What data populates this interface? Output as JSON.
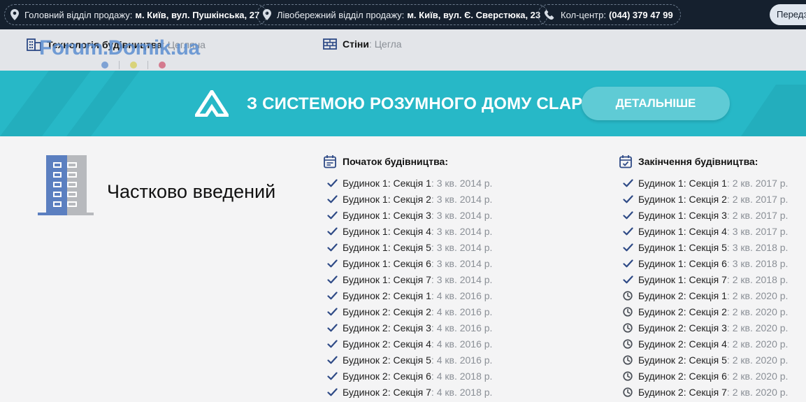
{
  "topbar": {
    "offices": [
      {
        "label": "Головний відділ продажу:",
        "value": "м. Київ, вул. Пушкінська, 27"
      },
      {
        "label": "Лівобережний відділ продажу:",
        "value": "м. Київ, вул. Є. Сверстюка, 23"
      }
    ],
    "callcenter": {
      "label": "Кол-центр:",
      "value": "(044) 379 47 99"
    },
    "callback_label": "Передз"
  },
  "specs": {
    "technology": {
      "label": "Технологія будівництва",
      "value": ": Цегляна"
    },
    "walls": {
      "label": "Стіни",
      "value": ": Цегла"
    },
    "watermark": "Forum.Domik.ua"
  },
  "banner": {
    "title": "З СИСТЕМОЮ РОЗУМНОГО ДОМУ CLAP",
    "button": "ДЕТАЛЬНІШЕ"
  },
  "status": {
    "text": "Частково введений"
  },
  "start": {
    "title": "Початок будівництва:",
    "items": [
      {
        "name": "Будинок 1: Секція 1",
        "date": ": 3 кв. 2014 р.",
        "icon": "check-icon"
      },
      {
        "name": "Будинок 1: Секція 2",
        "date": ": 3 кв. 2014 р.",
        "icon": "check-icon"
      },
      {
        "name": "Будинок 1: Секція 3",
        "date": ": 3 кв. 2014 р.",
        "icon": "check-icon"
      },
      {
        "name": "Будинок 1: Секція 4",
        "date": ": 3 кв. 2014 р.",
        "icon": "check-icon"
      },
      {
        "name": "Будинок 1: Секція 5",
        "date": ": 3 кв. 2014 р.",
        "icon": "check-icon"
      },
      {
        "name": "Будинок 1: Секція 6",
        "date": ": 3 кв. 2014 р.",
        "icon": "check-icon"
      },
      {
        "name": "Будинок 1: Секція 7",
        "date": ": 3 кв. 2014 р.",
        "icon": "check-icon"
      },
      {
        "name": "Будинок 2: Секція 1",
        "date": ": 4 кв. 2016 р.",
        "icon": "check-icon"
      },
      {
        "name": "Будинок 2: Секція 2",
        "date": ": 4 кв. 2016 р.",
        "icon": "check-icon"
      },
      {
        "name": "Будинок 2: Секція 3",
        "date": ": 4 кв. 2016 р.",
        "icon": "check-icon"
      },
      {
        "name": "Будинок 2: Секція 4",
        "date": ": 4 кв. 2016 р.",
        "icon": "check-icon"
      },
      {
        "name": "Будинок 2: Секція 5",
        "date": ": 4 кв. 2016 р.",
        "icon": "check-icon"
      },
      {
        "name": "Будинок 2: Секція 6",
        "date": ": 4 кв. 2018 р.",
        "icon": "check-icon"
      },
      {
        "name": "Будинок 2: Секція 7",
        "date": ": 4 кв. 2018 р.",
        "icon": "check-icon"
      }
    ]
  },
  "end": {
    "title": "Закінчення будівництва:",
    "items": [
      {
        "name": "Будинок 1: Секція 1",
        "date": ": 2 кв. 2017 р.",
        "icon": "check-icon"
      },
      {
        "name": "Будинок 1: Секція 2",
        "date": ": 2 кв. 2017 р.",
        "icon": "check-icon"
      },
      {
        "name": "Будинок 1: Секція 3",
        "date": ": 2 кв. 2017 р.",
        "icon": "check-icon"
      },
      {
        "name": "Будинок 1: Секція 4",
        "date": ": 3 кв. 2017 р.",
        "icon": "check-icon"
      },
      {
        "name": "Будинок 1: Секція 5",
        "date": ": 3 кв. 2018 р.",
        "icon": "check-icon"
      },
      {
        "name": "Будинок 1: Секція 6",
        "date": ": 3 кв. 2018 р.",
        "icon": "check-icon"
      },
      {
        "name": "Будинок 1: Секція 7",
        "date": ": 2 кв. 2018 р.",
        "icon": "check-icon"
      },
      {
        "name": "Будинок 2: Секція 1",
        "date": ": 2 кв. 2020 р.",
        "icon": "clock-icon"
      },
      {
        "name": "Будинок 2: Секція 2",
        "date": ": 2 кв. 2020 р.",
        "icon": "clock-icon"
      },
      {
        "name": "Будинок 2: Секція 3",
        "date": ": 2 кв. 2020 р.",
        "icon": "clock-icon"
      },
      {
        "name": "Будинок 2: Секція 4",
        "date": ": 2 кв. 2020 р.",
        "icon": "clock-icon"
      },
      {
        "name": "Будинок 2: Секція 5",
        "date": ": 2 кв. 2020 р.",
        "icon": "clock-icon"
      },
      {
        "name": "Будинок 2: Секція 6",
        "date": ": 2 кв. 2020 р.",
        "icon": "clock-icon"
      },
      {
        "name": "Будинок 2: Секція 7",
        "date": ": 2 кв. 2020 р.",
        "icon": "clock-icon"
      }
    ]
  },
  "colors": {
    "topbar_bg": "#15202e",
    "banner_bg": "#27b8c7",
    "accent_blue": "#2e4a86",
    "building_blue": "#5b7fc0",
    "building_gray": "#b7b9bd"
  }
}
